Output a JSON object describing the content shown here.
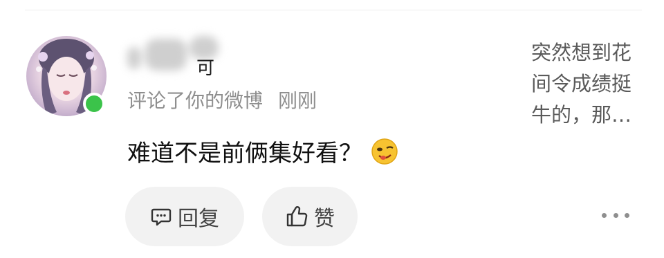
{
  "comment": {
    "author_name_visible": "可",
    "action_text": "评论了你的微博",
    "time": "刚刚",
    "text": "难道不是前俩集好看？",
    "emoji": "smirk-emoji"
  },
  "quoted_post": {
    "excerpt": "突然想到花间令成绩挺牛的，那…"
  },
  "actions": {
    "reply_label": "回复",
    "like_label": "赞"
  },
  "icons": {
    "reply": "comment-bubble-icon",
    "like": "thumbs-up-icon",
    "more": "more-dots-icon"
  },
  "colors": {
    "online": "#3bc34a",
    "meta_text": "#8e8e8e",
    "pill_bg": "#f2f2f2"
  }
}
